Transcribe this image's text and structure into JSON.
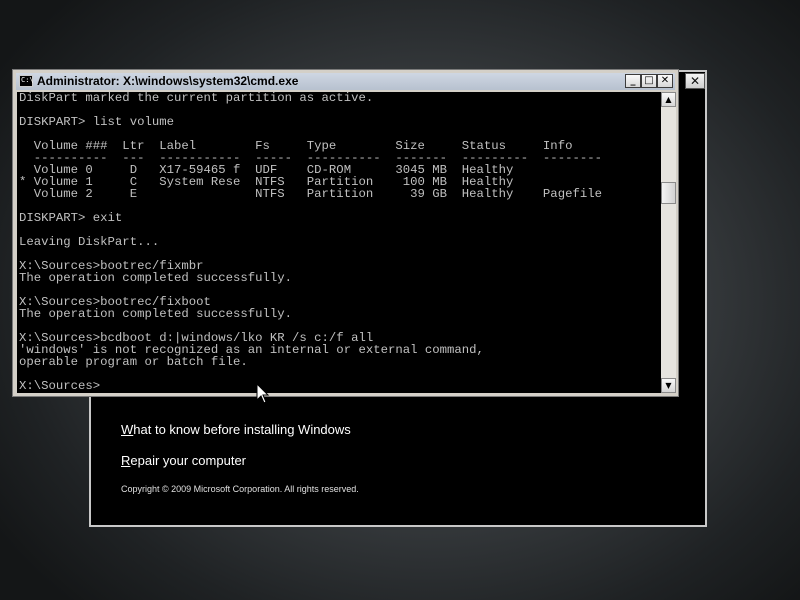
{
  "setup": {
    "close_label": "✕",
    "link_what_to_know_first": "W",
    "link_what_to_know_rest": "hat to know before installing Windows",
    "link_repair_first": "R",
    "link_repair_rest": "epair your computer",
    "copyright": "Copyright © 2009 Microsoft Corporation. All rights reserved."
  },
  "cmd": {
    "title": "Administrator: X:\\windows\\system32\\cmd.exe",
    "icon_text": "C:\\",
    "minimize_label": "_",
    "maximize_label": "□",
    "close_label": "✕",
    "console_lines": [
      "DiskPart marked the current partition as active.",
      "",
      "DISKPART> list volume",
      "",
      "  Volume ###  Ltr  Label        Fs     Type        Size     Status     Info",
      "  ----------  ---  -----------  -----  ----------  -------  ---------  --------",
      "  Volume 0     D   X17-59465 f  UDF    CD-ROM      3045 MB  Healthy",
      "* Volume 1     C   System Rese  NTFS   Partition    100 MB  Healthy",
      "  Volume 2     E                NTFS   Partition     39 GB  Healthy    Pagefile",
      "",
      "DISKPART> exit",
      "",
      "Leaving DiskPart...",
      "",
      "X:\\Sources>bootrec/fixmbr",
      "The operation completed successfully.",
      "",
      "X:\\Sources>bootrec/fixboot",
      "The operation completed successfully.",
      "",
      "X:\\Sources>bcdboot d:|windows/lko KR /s c:/f all",
      "'windows' is not recognized as an internal or external command,",
      "operable program or batch file.",
      "",
      "X:\\Sources>"
    ]
  },
  "scrollbar": {
    "up_arrow": "▲",
    "down_arrow": "▼"
  },
  "background_color": "#3a3e41",
  "console_bg": "#000000",
  "console_fg": "#c0c0c0"
}
